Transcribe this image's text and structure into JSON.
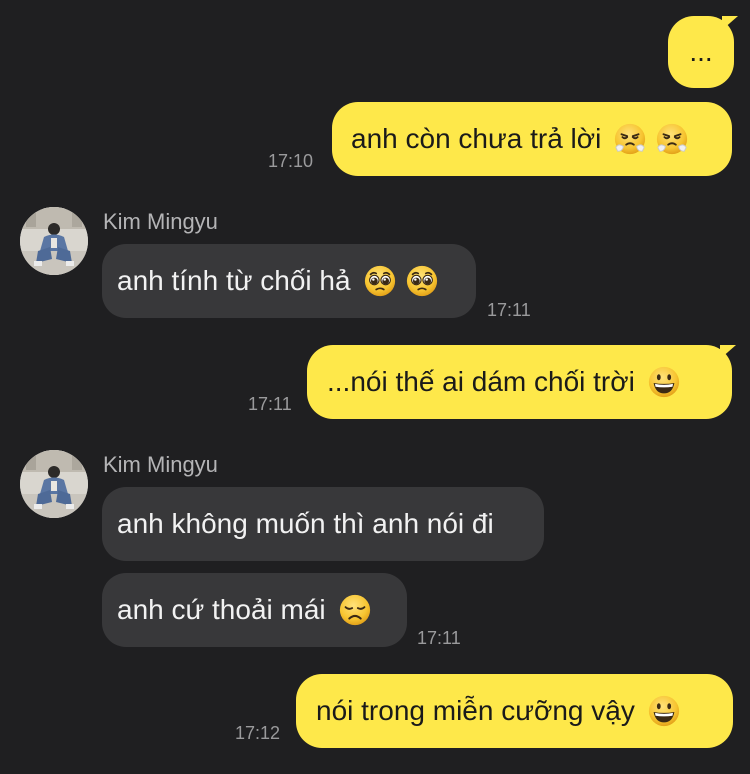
{
  "messages": {
    "m1": {
      "text": "..."
    },
    "m2": {
      "text": "anh còn chưa trả lời",
      "emojis": [
        "steam-face-icon",
        "steam-face-icon"
      ],
      "time": "17:10"
    },
    "m3": {
      "sender": "Kim Mingyu",
      "text": "anh tính từ chối hả",
      "emojis": [
        "pleading-face-icon",
        "pleading-face-icon"
      ],
      "time": "17:11"
    },
    "m4": {
      "text": "...nói thế ai dám chối trời",
      "emojis": [
        "grinning-face-icon"
      ],
      "time": "17:11"
    },
    "m5": {
      "sender": "Kim Mingyu",
      "text": "anh không muốn thì anh nói đi"
    },
    "m6": {
      "text": "anh cứ thoải mái",
      "emojis": [
        "disappointed-face-icon"
      ],
      "time": "17:11"
    },
    "m7": {
      "text": "nói trong miễn cưỡng vậy",
      "emojis": [
        "grinning-face-icon"
      ],
      "time": "17:12"
    }
  },
  "colors": {
    "background": "#1f1f21",
    "my_bubble": "#fee84a",
    "their_bubble": "#38383a",
    "timestamp": "#9a9a9c",
    "sender_name": "#b4b4b6",
    "emoji_face": "#f7c531"
  }
}
